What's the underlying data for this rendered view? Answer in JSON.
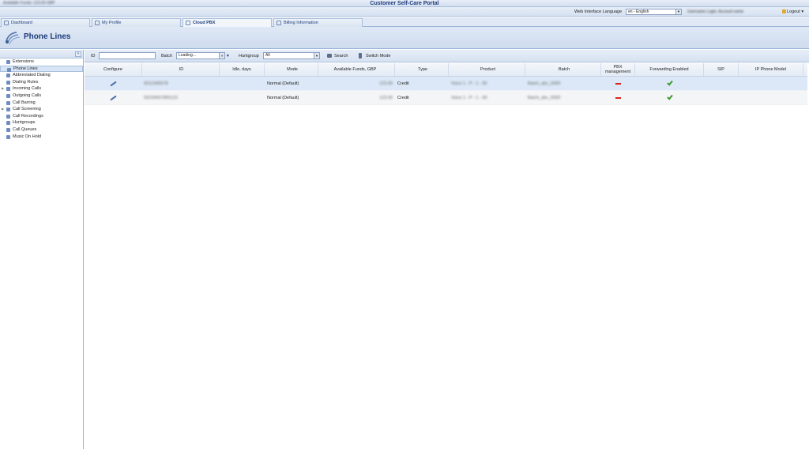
{
  "app": {
    "title": "Customer Self-Care Portal",
    "account_blurred": "Available Funds: 123.00 GBP"
  },
  "langbar": {
    "label": "Web Interface Language",
    "language_value": "en - English",
    "user_info_blurred": "Username Login: Account name",
    "logout_label": "Logout"
  },
  "tabs": [
    {
      "label": "Dashboard",
      "icon": "dashboard-icon"
    },
    {
      "label": "My Profile",
      "icon": "profile-icon"
    },
    {
      "label": "Cloud PBX",
      "icon": "cloud-pbx-icon"
    },
    {
      "label": "Billing Information",
      "icon": "billing-icon"
    }
  ],
  "header": {
    "title": "Phone Lines",
    "icon": "phone-lines-icon"
  },
  "sidebar": {
    "collapse_label": "«",
    "items": [
      {
        "label": "Extensions"
      },
      {
        "label": "Phone Lines"
      },
      {
        "label": "Abbreviated Dialing"
      },
      {
        "label": "Dialing Rules"
      },
      {
        "label": "Incoming Calls"
      },
      {
        "label": "Outgoing Calls"
      },
      {
        "label": "Call Barring"
      },
      {
        "label": "Call Screening"
      },
      {
        "label": "Call Recordings"
      },
      {
        "label": "Huntgroups"
      },
      {
        "label": "Call Queues"
      },
      {
        "label": "Music On Hold"
      }
    ]
  },
  "toolbar": {
    "id_label": "ID",
    "id_value": "",
    "batch_label": "Batch",
    "batch_value": "Loading...",
    "huntgroup_label": "Huntgroup",
    "huntgroup_value": "All",
    "search_label": "Search",
    "switch_mode_label": "Switch Mode"
  },
  "grid": {
    "columns": {
      "configure": "Configure",
      "id": "ID",
      "idle": "Idle, days",
      "mode": "Mode",
      "funds": "Available Funds, GBP",
      "type": "Type",
      "product": "Product",
      "batch": "Batch",
      "pbx": "PBX management",
      "fwd": "Forwarding Enabled",
      "sip": "SIP",
      "model": "IP Phone Model"
    },
    "rows": [
      {
        "id": "0012345678",
        "idle": "",
        "mode": "Normal (Default)",
        "funds": "123.00",
        "type": "Credit",
        "product": "Voice 1 - P - 1 - 00",
        "batch": "Batch_abc_0000",
        "pbx": "disabled",
        "fwd": "enabled",
        "sip": "",
        "model": ""
      },
      {
        "id": "00234567890123",
        "idle": "",
        "mode": "Normal (Default)",
        "funds": "123.00",
        "type": "Credit",
        "product": "Voice 1 - P - 1 - 00",
        "batch": "Batch_abc_0000",
        "pbx": "disabled",
        "fwd": "enabled",
        "sip": "",
        "model": ""
      }
    ]
  }
}
